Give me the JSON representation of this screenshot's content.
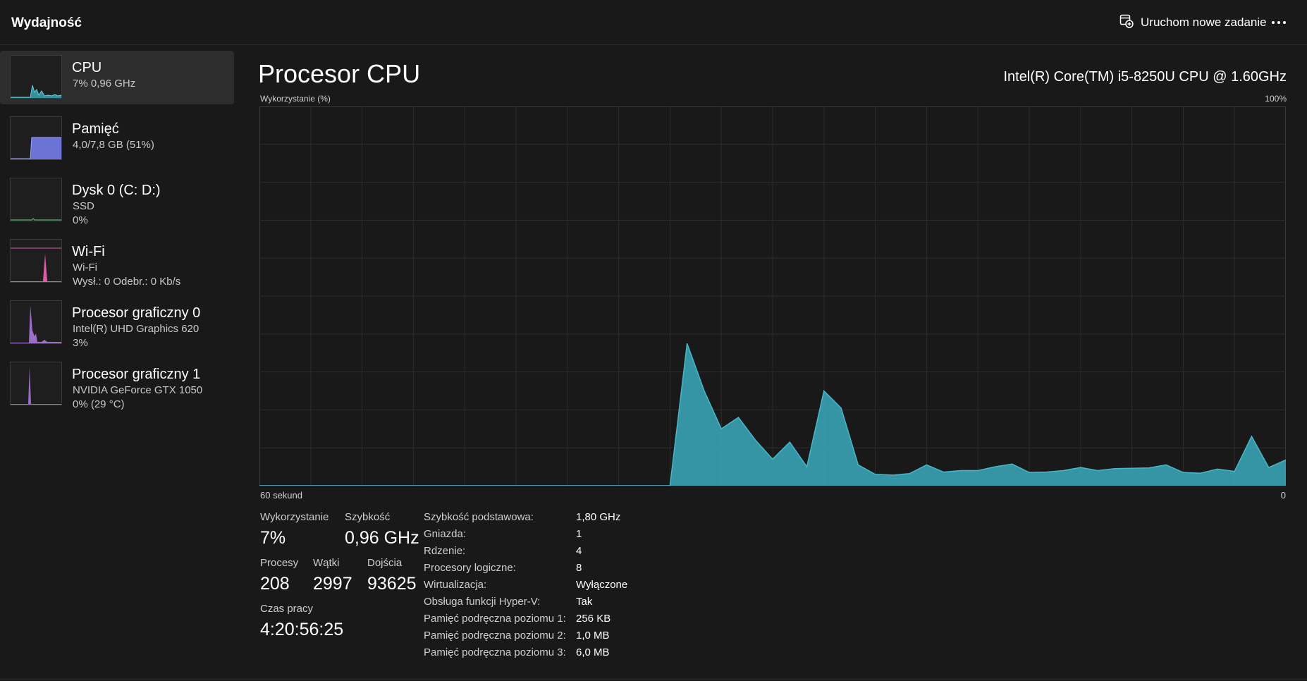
{
  "header": {
    "title": "Wydajność",
    "new_task_label": "Uruchom nowe zadanie"
  },
  "sidebar": {
    "items": [
      {
        "title": "CPU",
        "sub1": "7% 0,96 GHz",
        "sub2": "",
        "color": "#3aa3b4"
      },
      {
        "title": "Pamięć",
        "sub1": "4,0/7,8 GB (51%)",
        "sub2": "",
        "color": "#6b73d6"
      },
      {
        "title": "Dysk 0 (C: D:)",
        "sub1": "SSD",
        "sub2": "0%",
        "color": "#4a9a5e"
      },
      {
        "title": "Wi-Fi",
        "sub1": "Wi-Fi",
        "sub2": "Wysł.: 0 Odebr.: 0 Kb/s",
        "color": "#e05cab"
      },
      {
        "title": "Procesor graficzny 0",
        "sub1": "Intel(R) UHD Graphics 620",
        "sub2": "3%",
        "color": "#9a6ec9"
      },
      {
        "title": "Procesor graficzny 1",
        "sub1": "NVIDIA GeForce GTX 1050",
        "sub2": "0% (29 °C)",
        "color": "#9a6ec9"
      }
    ]
  },
  "main": {
    "title": "Procesor CPU",
    "cpu_name": "Intel(R) Core(TM) i5-8250U CPU @ 1.60GHz",
    "chart_label": "Wykorzystanie (%)",
    "chart_max_label": "100%",
    "time_label": "60 sekund",
    "time_min_label": "0"
  },
  "chart_data": {
    "type": "area",
    "ylim": [
      0,
      100
    ],
    "xlim": [
      60,
      0
    ],
    "grid": true,
    "color": "#3aa3b4",
    "x": [
      60,
      59,
      58,
      57,
      56,
      55,
      54,
      53,
      52,
      51,
      50,
      49,
      48,
      47,
      46,
      45,
      44,
      43,
      42,
      41,
      40,
      39,
      38,
      37,
      36,
      35,
      34,
      33,
      32,
      31,
      30,
      29,
      28,
      27,
      26,
      25,
      24,
      23,
      22,
      21,
      20,
      19,
      18,
      17,
      16,
      15,
      14,
      13,
      12,
      11,
      10,
      9,
      8,
      7,
      6,
      5,
      4,
      3,
      2,
      1,
      0
    ],
    "values": [
      0,
      0,
      0,
      0,
      0,
      0,
      0,
      0,
      0,
      0,
      0,
      0,
      0,
      0,
      0,
      0,
      0,
      0,
      0,
      0,
      0,
      0,
      0,
      0,
      0,
      37.5,
      25,
      15,
      18,
      12,
      7,
      11.5,
      5,
      25,
      20.5,
      5.5,
      3,
      2.8,
      3.2,
      5.5,
      3.6,
      4,
      4,
      5,
      5.7,
      3.5,
      3.6,
      4,
      4.8,
      4,
      4.5,
      4.6,
      4.7,
      5.5,
      3.5,
      3.3,
      4.4,
      3.8,
      13,
      4.8,
      6.8
    ]
  },
  "stats": {
    "utilization_label": "Wykorzystanie",
    "utilization_value": "7%",
    "speed_label": "Szybkość",
    "speed_value": "0,96 GHz",
    "processes_label": "Procesy",
    "processes_value": "208",
    "threads_label": "Wątki",
    "threads_value": "2997",
    "handles_label": "Dojścia",
    "handles_value": "93625",
    "uptime_label": "Czas pracy",
    "uptime_value": "4:20:56:25"
  },
  "specs": [
    {
      "key": "Szybkość podstawowa:",
      "value": "1,80 GHz"
    },
    {
      "key": "Gniazda:",
      "value": "1"
    },
    {
      "key": "Rdzenie:",
      "value": "4"
    },
    {
      "key": "Procesory logiczne:",
      "value": "8"
    },
    {
      "key": "Wirtualizacja:",
      "value": "Wyłączone"
    },
    {
      "key": "Obsługa funkcji Hyper-V:",
      "value": "Tak"
    },
    {
      "key": "Pamięć podręczna poziomu 1:",
      "value": "256 KB"
    },
    {
      "key": "Pamięć podręczna poziomu 2:",
      "value": "1,0 MB"
    },
    {
      "key": "Pamięć podręczna poziomu 3:",
      "value": "6,0 MB"
    }
  ]
}
